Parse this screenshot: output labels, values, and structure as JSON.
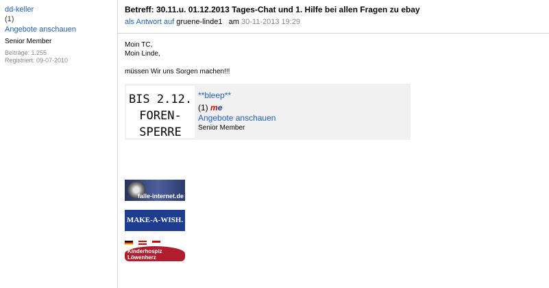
{
  "user": {
    "name": "dd-keller",
    "feedback": "(1)",
    "offers_link": "Angebote anschauen",
    "rank": "Senior Member",
    "posts": "Beiträge: 1.255",
    "registered": "Registriert: 09-07-2010"
  },
  "post": {
    "title": "Betreff: 30.11.u. 01.12.2013 Tages-Chat und 1. Hilfe bei allen Fragen zu ebay",
    "reply_prefix": "als Antwort auf",
    "reply_to": "gruene-linde1",
    "date_prefix": "am",
    "date": "30-11-2013 19:29",
    "body": [
      "Moin TC,",
      "Moin Linde,",
      "müssen Wir uns Sorgen machen!!!"
    ]
  },
  "signature_card": {
    "avatar_lines": [
      "BIS 2.12.",
      "FOREN-",
      "SPERRE"
    ],
    "name": "**bleep**",
    "feedback": "(1)",
    "feedback_logo": "me",
    "offers_link": "Angebote anschauen",
    "rank": "Senior Member"
  },
  "banners": {
    "falle": "falle-internet.de",
    "wish": "MAKE-A-WISH.",
    "hospiz": "Kinderhospiz Löwenherz"
  },
  "colors": {
    "link": "#1f5fb8",
    "muted": "#888888",
    "divider": "#d4d4d4",
    "sig_bg": "#f1f1f1"
  }
}
